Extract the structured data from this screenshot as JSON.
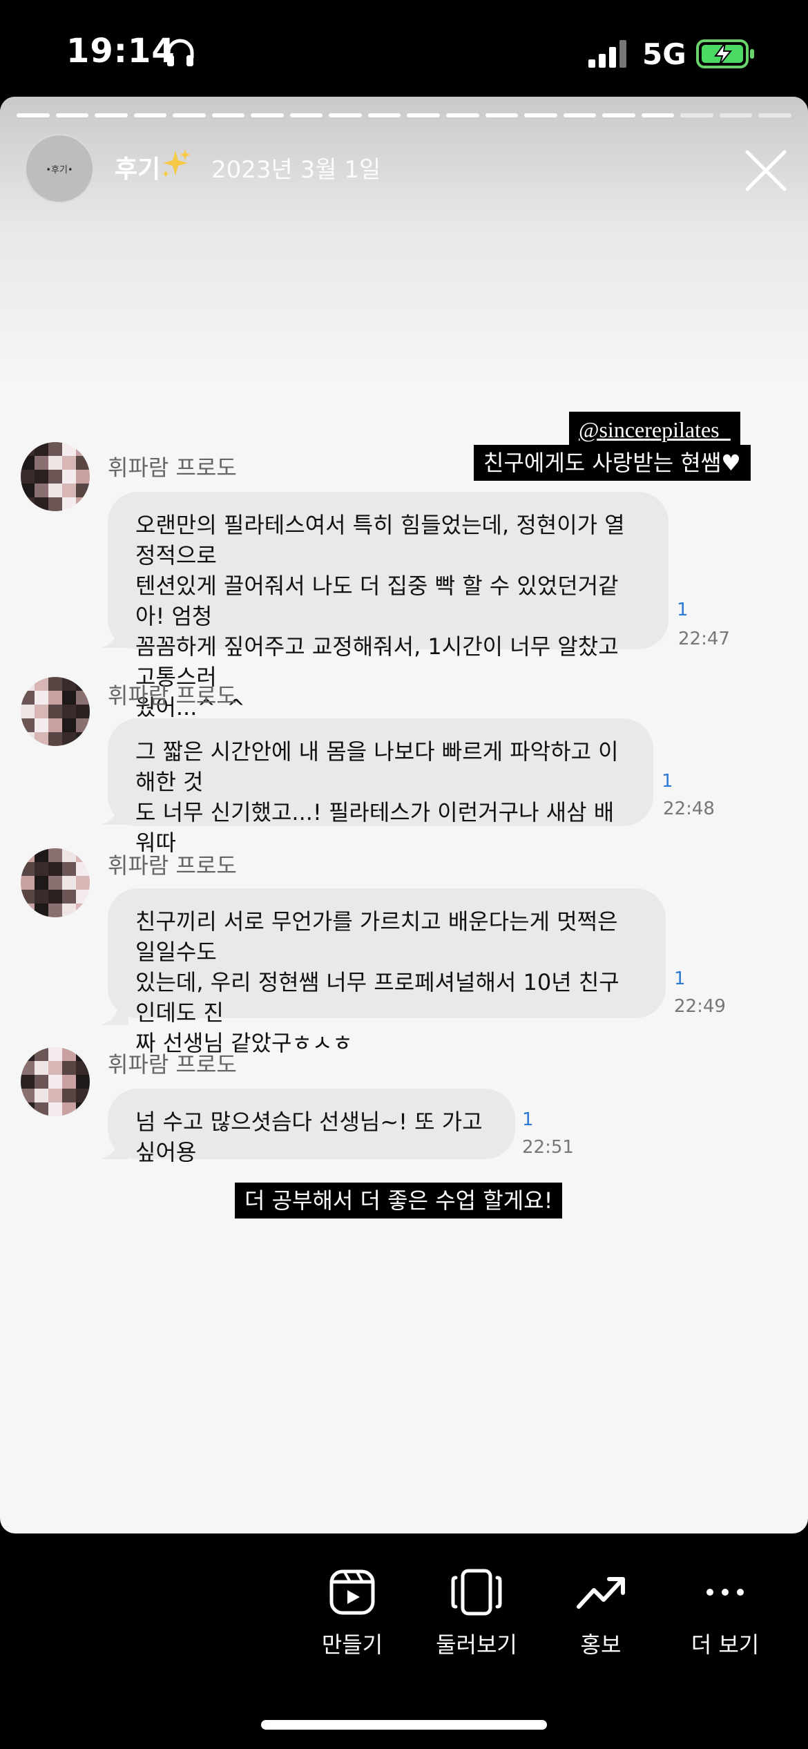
{
  "status_bar": {
    "time": "19:14",
    "network": "5G"
  },
  "story": {
    "segments_total": 20,
    "segments_done": 17,
    "profile": {
      "name": "후기",
      "avatar_text": "•후기•",
      "date": "2023년 3월 1일"
    },
    "mention": "@sincerepilates_",
    "caption_top": "친구에게도 사랑받는 현쌤♥",
    "caption_bottom": "더 공부해서 더 좋은 수업 할게요!"
  },
  "chat": {
    "sender": "휘파람 프로도",
    "messages": [
      {
        "lines": [
          "오랜만의 필라테스여서 특히 힘들었는데, 정현이가 열정적으로",
          "텐션있게 끌어줘서 나도 더 집중 빡 할 수 있었던거같아! 엄청",
          "꼼꼼하게 짚어주고 교정해줘서, 1시간이 너무 알찼고 고통스러",
          "웠어...^_^"
        ],
        "read": "1",
        "time": "22:47"
      },
      {
        "lines": [
          "그 짧은 시간안에 내 몸을 나보다 빠르게 파악하고 이해한 것",
          "도 너무 신기했고...! 필라테스가 이런거구나 새삼 배워따"
        ],
        "read": "1",
        "time": "22:48"
      },
      {
        "lines": [
          "친구끼리 서로 무언가를 가르치고 배운다는게 멋쩍은 일일수도",
          "있는데, 우리 정현쌤 너무 프로페셔널해서 10년 친구인데도 진",
          "짜 선생님 같았구ㅎㅅㅎ"
        ],
        "read": "1",
        "time": "22:49"
      },
      {
        "lines": [
          "넘 수고 많으셧슴다 선생님~! 또 가고싶어용"
        ],
        "read": "1",
        "time": "22:51"
      }
    ]
  },
  "bottom_bar": {
    "actions": [
      {
        "label": "만들기",
        "icon": "reels-create-icon"
      },
      {
        "label": "둘러보기",
        "icon": "browse-icon"
      },
      {
        "label": "홍보",
        "icon": "trending-up-icon"
      },
      {
        "label": "더 보기",
        "icon": "more-icon"
      }
    ]
  }
}
